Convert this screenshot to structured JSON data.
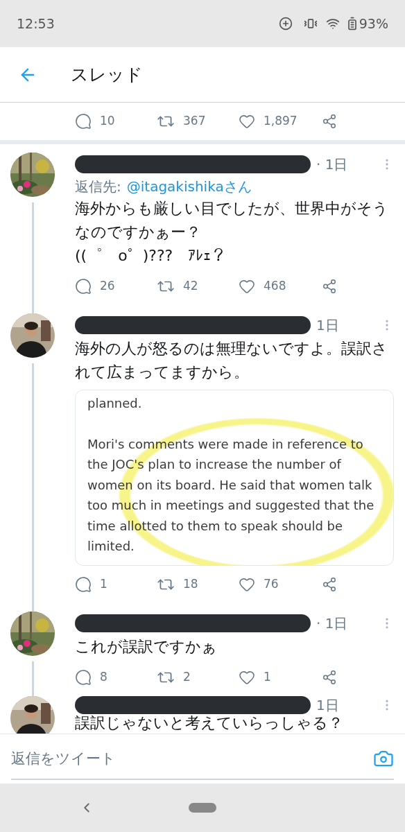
{
  "status_bar": {
    "time": "12:53",
    "battery": "93%"
  },
  "header": {
    "title": "スレッド"
  },
  "tweets": [
    {
      "kind": "partial",
      "stats": {
        "replies": "10",
        "retweets": "367",
        "likes": "1,897"
      }
    },
    {
      "kind": "tweet",
      "time": "· 1日",
      "reply_to_label": "返信先:",
      "reply_to_handle": "@itagakishikaさん",
      "body": "海外からも厳しい目でしたが、世界中がそうなのですかぁー？\n((゜　o゜)???　ｱﾚｪ？",
      "stats": {
        "replies": "26",
        "retweets": "42",
        "likes": "468"
      }
    },
    {
      "kind": "tweet",
      "time": "1日",
      "body": "海外の人が怒るのは無理ないですよ。誤訳されて広まってますから。",
      "card_paragraphs": [
        "planned.",
        "Mori's comments were made in reference to the JOC's plan to increase the number of women on its board. He said that women talk too much in meetings and suggested that the time allotted to them to speak should be limited."
      ],
      "stats": {
        "replies": "1",
        "retweets": "18",
        "likes": "76"
      }
    },
    {
      "kind": "tweet",
      "time": "· 1日",
      "body": "これが誤訳ですかぁ",
      "stats": {
        "replies": "8",
        "retweets": "2",
        "likes": "1"
      }
    },
    {
      "kind": "cut",
      "time": "1日",
      "body": "誤訳じゃないと考えていらっしゃる？"
    }
  ],
  "compose": {
    "placeholder": "返信をツイート"
  }
}
